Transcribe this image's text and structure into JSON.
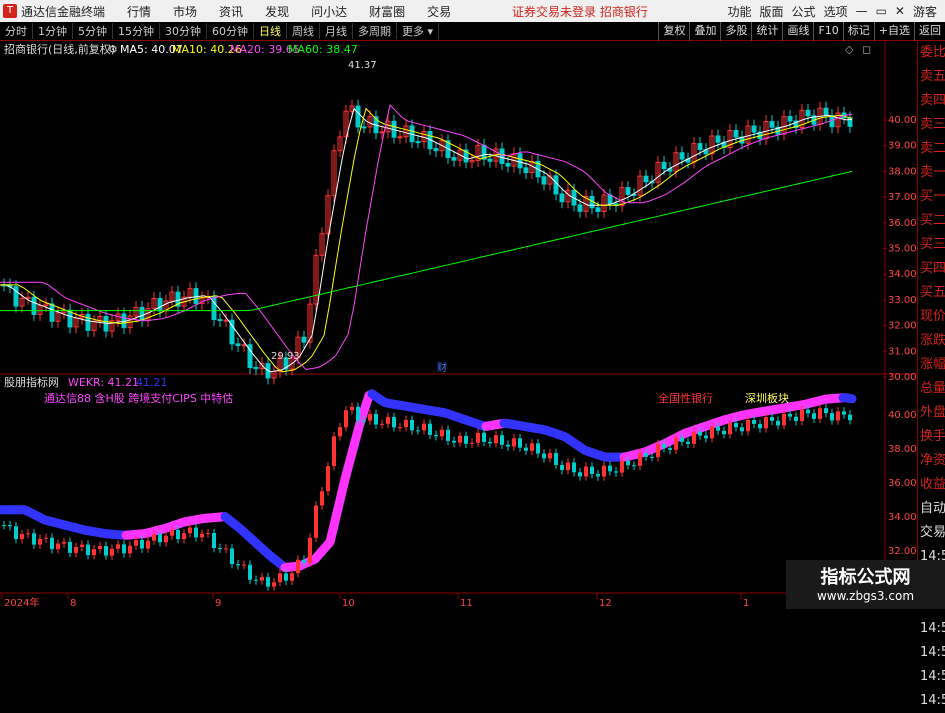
{
  "titlebar": {
    "app": "通达信金融终端",
    "menus": [
      "行情",
      "市场",
      "资讯",
      "发现",
      "问小达",
      "财富圈",
      "交易"
    ],
    "notice": "证券交易未登录",
    "bank": "招商银行",
    "right": [
      "功能",
      "版面",
      "公式",
      "选项"
    ],
    "user": "游客"
  },
  "toolbar": {
    "periods": [
      "分时",
      "1分钟",
      "5分钟",
      "15分钟",
      "30分钟",
      "60分钟",
      "日线",
      "周线",
      "月线",
      "多周期",
      "更多"
    ],
    "active": "日线",
    "right": [
      "复权",
      "叠加",
      "多股",
      "统计",
      "画线",
      "F10",
      "标记",
      "+自选",
      "返回"
    ]
  },
  "main_header": {
    "stock": "招商银行(日线,前复权)",
    "ma5": "MA5: 40.07",
    "ma10": "MA10: 40.26",
    "ma20": "MA20: 39.65",
    "ma60": "MA60: 38.47"
  },
  "main_axis": [
    "40.00",
    "39.00",
    "38.00",
    "37.00",
    "36.00",
    "35.00",
    "34.00",
    "33.00",
    "32.00",
    "31.00",
    "30.00"
  ],
  "marks": {
    "high": "41.37",
    "low": "29.93",
    "cai": "财"
  },
  "sub_header": {
    "name": "股朋指标网",
    "indicator": "WEKR: 41.21",
    "value2": "41.21",
    "concepts": "通达信88 含H股 跨境支付CIPS 中特估",
    "tag1": "全国性银行",
    "tag2": "深圳板块"
  },
  "sub_axis": [
    "40.00",
    "38.00",
    "36.00",
    "34.00",
    "32.00"
  ],
  "dates": [
    "2024年",
    "8",
    "9",
    "10",
    "11",
    "12",
    "1"
  ],
  "side_panel": [
    "委比",
    "卖五",
    "卖四",
    "卖三",
    "卖二",
    "卖一",
    "买一",
    "买二",
    "买三",
    "买四",
    "买五",
    "现价",
    "涨跌",
    "涨幅",
    "总量",
    "外盘",
    "换手",
    "净资",
    "收益",
    "自动",
    "交易",
    "14:56",
    "14:56",
    "14:56",
    "14:56",
    "14:56",
    "14:56",
    "14:56"
  ],
  "watermark": {
    "line1": "指标公式网",
    "line2": "www.zbgs3.com"
  },
  "colors": {
    "up": "#ff3333",
    "down": "#00cccc",
    "ma5": "#ffffff",
    "ma10": "#ffff00",
    "ma20": "#ff44ff",
    "ma60": "#00ff00",
    "wekr_down": "#3333ff",
    "wekr_up": "#ff33ff"
  }
}
